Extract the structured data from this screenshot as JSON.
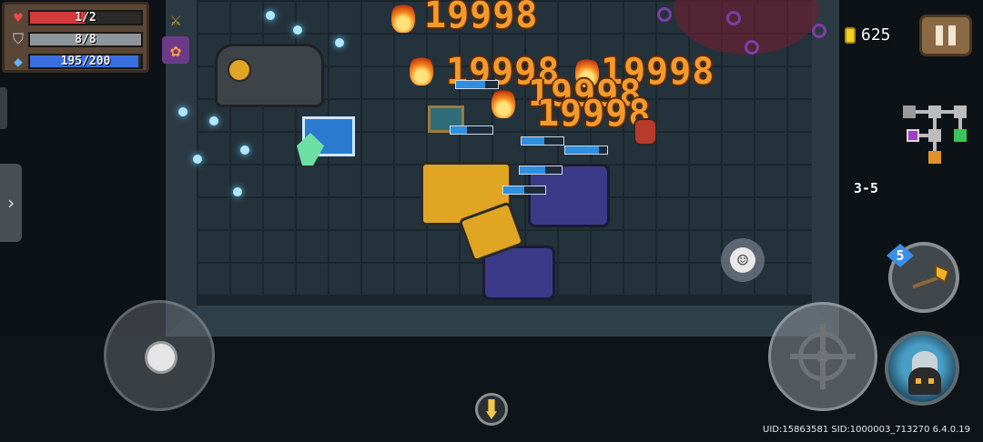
{
  "stats": {
    "hp": {
      "current": 1,
      "max": 2,
      "label": "1/2",
      "color": "#d23a3a"
    },
    "armor": {
      "current": 8,
      "max": 8,
      "label": "8/8",
      "color": "#8e969c"
    },
    "energy": {
      "current": 195,
      "max": 200,
      "label": "195/200",
      "color": "#3a6fe0"
    }
  },
  "gold": {
    "amount": "625"
  },
  "level": {
    "label": "3-5"
  },
  "damage_numbers": [
    "19998",
    "19998",
    "19998",
    "19998",
    "19998"
  ],
  "weapon": {
    "energy_cost": "5"
  },
  "footer": {
    "uid_text": "UID:15863581 SID:1000003_713270 6.4.0.19"
  },
  "icons": {
    "hp": "heart-icon",
    "armor": "shield-icon",
    "energy": "diamond-icon",
    "pause": "pause-icon",
    "emote": "smiley-icon",
    "fire": "crosshair-icon",
    "drawer": "chevron-right-icon"
  }
}
